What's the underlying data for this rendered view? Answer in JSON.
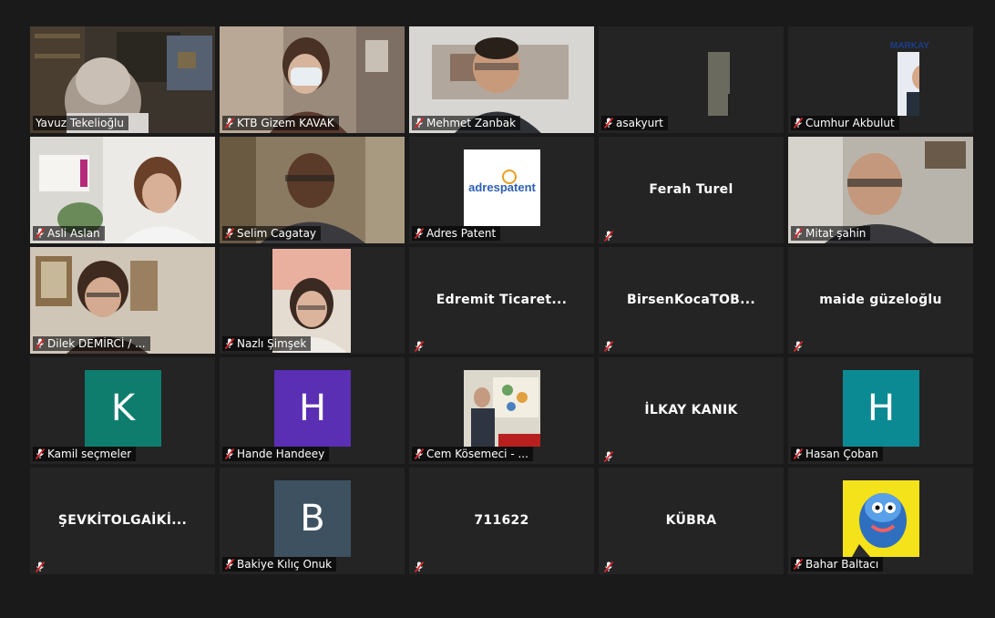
{
  "colors": {
    "background": "#1a1a1a",
    "tile": "#242424",
    "active_speaker_border": "#c8e06a",
    "muted_icon": "#e0242a"
  },
  "participants": [
    {
      "name": "Yavuz Tekelioğlu",
      "label": "Yavuz Tekelioğlu",
      "type": "video",
      "muted": false,
      "active": true
    },
    {
      "name": "KTB Gizem KAVAK",
      "label": "KTB Gizem KAVAK",
      "type": "video",
      "muted": true
    },
    {
      "name": "Mehmet Zanbak",
      "label": "Mehmet Zanbak",
      "type": "video",
      "muted": true
    },
    {
      "name": "asakyurt",
      "label": "asakyurt",
      "type": "photo",
      "muted": true
    },
    {
      "name": "Cumhur Akbulut",
      "label": "Cumhur Akbulut",
      "type": "photo",
      "muted": true,
      "photo_text": "MARKAY"
    },
    {
      "name": "Asli Aslan",
      "label": "Asli Aslan",
      "type": "video",
      "muted": true
    },
    {
      "name": "Selim Cagatay",
      "label": "Selim Cagatay",
      "type": "video",
      "muted": true
    },
    {
      "name": "Adres Patent",
      "label": "Adres Patent",
      "type": "logo",
      "muted": true,
      "logo_text_left": "adres",
      "logo_text_right": "patent"
    },
    {
      "name": "Ferah Turel",
      "label": "",
      "type": "name",
      "muted": true
    },
    {
      "name": "Mitat şahin",
      "label": "Mitat şahin",
      "type": "video",
      "muted": true
    },
    {
      "name": "Dilek DEMİRCİ / ...",
      "label": "Dilek DEMİRCİ / ...",
      "type": "video",
      "muted": true
    },
    {
      "name": "Nazlı Şimşek",
      "label": "Nazlı Şimşek",
      "type": "video-narrow",
      "muted": true
    },
    {
      "name": "Edremit Ticaret...",
      "label": "",
      "type": "name",
      "muted": true
    },
    {
      "name": "BirsenKocaTOB...",
      "label": "",
      "type": "name",
      "muted": true
    },
    {
      "name": "maide güzeloğlu",
      "label": "",
      "type": "name",
      "muted": true
    },
    {
      "name": "Kamil seçmeler",
      "label": "Kamil seçmeler",
      "type": "avatar",
      "muted": true,
      "initial": "K",
      "color": "#0f7d6e"
    },
    {
      "name": "Hande Handeey",
      "label": "Hande Handeey",
      "type": "avatar",
      "muted": true,
      "initial": "H",
      "color": "#5a2fb3"
    },
    {
      "name": "Cem Kösemeci - ...",
      "label": "Cem Kösemeci - ...",
      "type": "photo",
      "muted": true
    },
    {
      "name": "İLKAY KANIK",
      "label": "",
      "type": "name",
      "muted": true
    },
    {
      "name": "Hasan Çoban",
      "label": "Hasan Çoban",
      "type": "avatar",
      "muted": true,
      "initial": "H",
      "color": "#0b8a93"
    },
    {
      "name": "ŞEVKİTOLGAİKİ...",
      "label": "",
      "type": "name",
      "muted": true
    },
    {
      "name": "Bakiye Kılıç Onuk",
      "label": "Bakiye Kılıç Onuk",
      "type": "avatar",
      "muted": true,
      "initial": "B",
      "color": "#3d5160"
    },
    {
      "name": "711622",
      "label": "",
      "type": "name",
      "muted": true
    },
    {
      "name": "KÜBRA",
      "label": "",
      "type": "name",
      "muted": true
    },
    {
      "name": "Bahar Baltacı",
      "label": "Bahar Baltacı",
      "type": "photo",
      "muted": true
    }
  ]
}
